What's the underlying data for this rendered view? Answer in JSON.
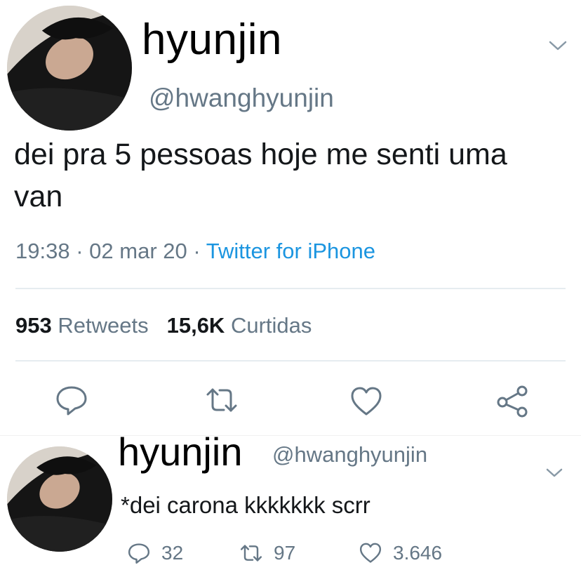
{
  "tweet": {
    "display_name": "hyunjin",
    "handle": "@hwanghyunjin",
    "text": "dei pra 5 pessoas hoje me senti uma van",
    "time": "19:38",
    "date": "02 mar 20",
    "separator": "·",
    "source": "Twitter for iPhone",
    "retweets_count": "953",
    "retweets_label": "Retweets",
    "likes_count": "15,6K",
    "likes_label": "Curtidas",
    "actions": [
      "reply-icon",
      "retweet-icon",
      "like-icon",
      "share-icon"
    ]
  },
  "reply": {
    "display_name": "hyunjin",
    "handle": "@hwanghyunjin",
    "text": "*dei carona kkkkkkk scrr",
    "replies": "32",
    "retweets": "97",
    "likes": "3.646"
  },
  "colors": {
    "text": "#14171a",
    "secondary": "#657786",
    "link": "#1b95e0",
    "divider": "#e6ecf0"
  }
}
